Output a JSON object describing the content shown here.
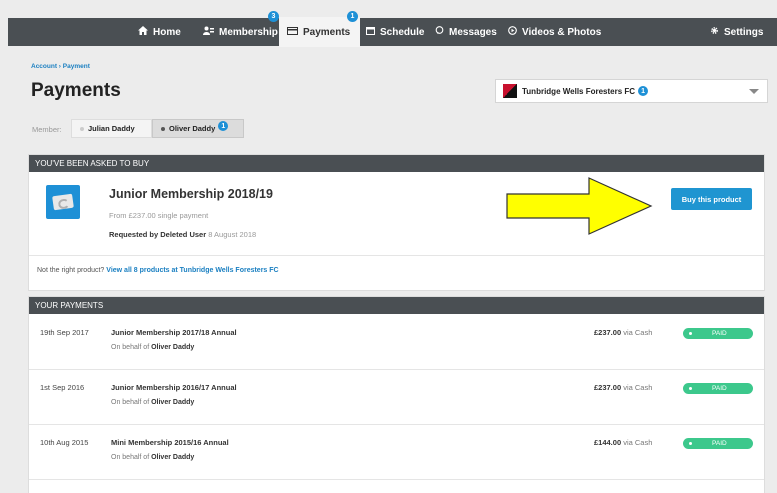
{
  "nav": {
    "items": [
      {
        "label": "Home",
        "icon": "home-icon"
      },
      {
        "label": "Membership",
        "icon": "membership-icon",
        "badge": "3"
      },
      {
        "label": "Payments",
        "icon": "payments-icon",
        "badge": "1",
        "active": true
      },
      {
        "label": "Schedule",
        "icon": "calendar-icon"
      },
      {
        "label": "Messages",
        "icon": "message-icon"
      },
      {
        "label": "Videos & Photos",
        "icon": "play-icon"
      },
      {
        "label": "Settings",
        "icon": "gear-icon"
      }
    ]
  },
  "breadcrumb": "Account › Payment",
  "page_title": "Payments",
  "club": {
    "name": "Tunbridge Wells Foresters FC",
    "badge": "1"
  },
  "member": {
    "label": "Member:",
    "tabs": [
      {
        "label": "Julian Daddy"
      },
      {
        "label": "Oliver Daddy",
        "badge": "1"
      }
    ]
  },
  "buy_section": {
    "header": "You've been asked to buy",
    "product_title": "Junior Membership 2018/19",
    "price_text": "From £237.00 single payment",
    "requested_by_label": "Requested by Deleted User",
    "requested_date": "8 August 2018",
    "buy_button": "Buy this product",
    "not_right_text": "Not the right product?",
    "view_all_link": "View all 8 products at Tunbridge Wells Foresters FC"
  },
  "payments_section": {
    "header": "Your payments",
    "rows": [
      {
        "date": "19th Sep 2017",
        "name": "Junior Membership 2017/18 Annual",
        "behalf_label": "On behalf of",
        "behalf_name": "Oliver Daddy",
        "amount": "£237.00",
        "via": "via Cash",
        "status": "PAID"
      },
      {
        "date": "1st Sep 2016",
        "name": "Junior Membership 2016/17 Annual",
        "behalf_label": "On behalf of",
        "behalf_name": "Oliver Daddy",
        "amount": "£237.00",
        "via": "via Cash",
        "status": "PAID"
      },
      {
        "date": "10th Aug 2015",
        "name": "Mini Membership 2015/16 Annual",
        "behalf_label": "On behalf of",
        "behalf_name": "Oliver Daddy",
        "amount": "£144.00",
        "via": "via Cash",
        "status": "PAID"
      }
    ]
  },
  "colors": {
    "navbar": "#4a4f53",
    "accent": "#1f95d1",
    "paid": "#3cc88c",
    "arrow": "#ffff00"
  }
}
